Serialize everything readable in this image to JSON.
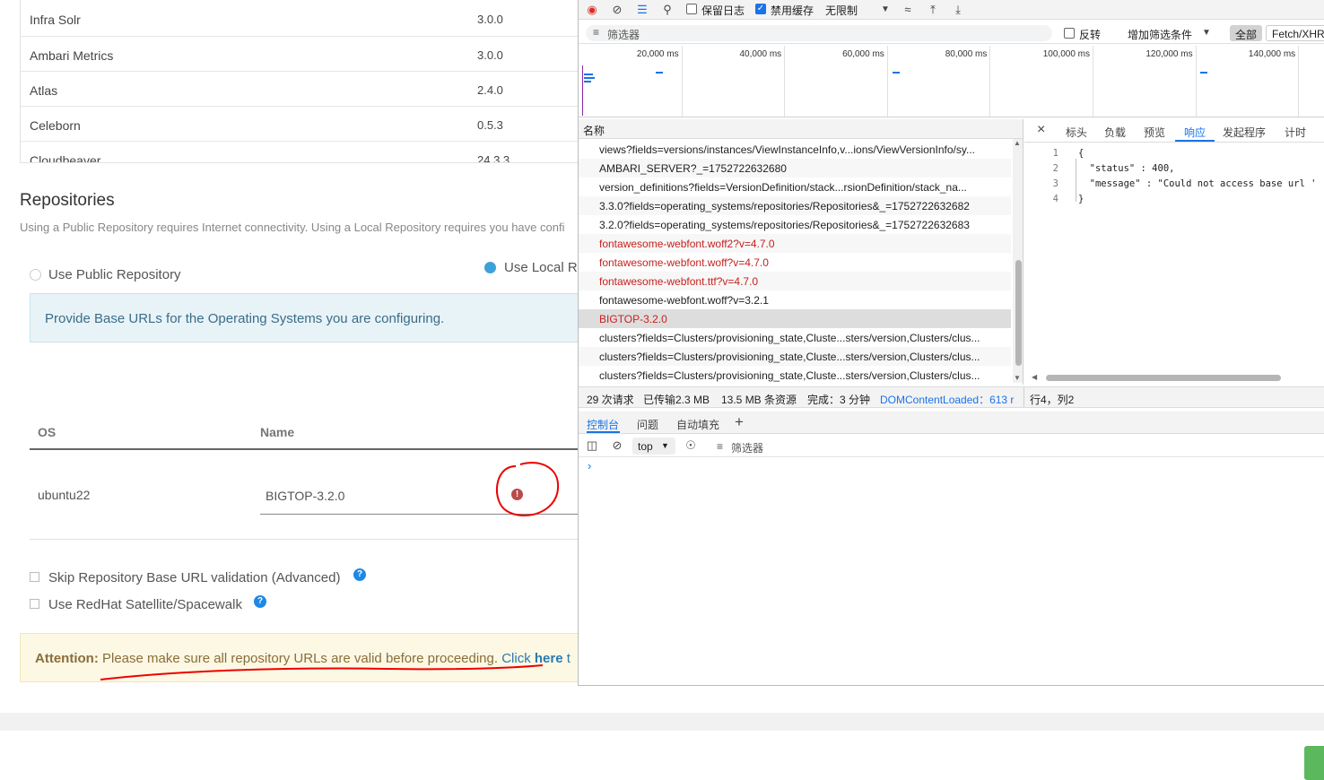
{
  "services": [
    {
      "name": "Infra Solr",
      "version": "3.0.0"
    },
    {
      "name": "Ambari Metrics",
      "version": "3.0.0"
    },
    {
      "name": "Atlas",
      "version": "2.4.0"
    },
    {
      "name": "Celeborn",
      "version": "0.5.3"
    },
    {
      "name": "Cloudbeaver",
      "version": "24.3.3"
    }
  ],
  "repositories": {
    "title": "Repositories",
    "description": "Using a Public Repository requires Internet connectivity. Using a Local Repository requires you have confi",
    "public_label": "Use Public Repository",
    "local_label": "Use Local R",
    "info": "Provide Base URLs for the Operating Systems you are configuring.",
    "col_os": "OS",
    "col_name": "Name",
    "os_value": "ubuntu22",
    "name_value": "BIGTOP-3.2.0",
    "error_glyph": "!",
    "skip_validation_label": "Skip Repository Base URL validation (Advanced)",
    "satellite_label": "Use RedHat Satellite/Spacewalk",
    "help_glyph": "?",
    "attention_label": "Attention:",
    "attention_text": " Please make sure all repository URLs are valid before proceeding. ",
    "attention_link_1": "Click ",
    "attention_link_2": "here",
    "attention_link_3": " t"
  },
  "devtools": {
    "toolbar": {
      "preserve_log": "保留日志",
      "disable_cache": "禁用缓存",
      "throttle": "无限制"
    },
    "filter": {
      "placeholder": "筛选器",
      "invert": "反转",
      "more_filters": "增加筛选条件",
      "all": "全部",
      "fetch_xhr": "Fetch/XHR"
    },
    "timeline_labels": [
      "20,000 ms",
      "40,000 ms",
      "60,000 ms",
      "80,000 ms",
      "100,000 ms",
      "120,000 ms",
      "140,000 ms"
    ],
    "name_header": "名称",
    "requests": [
      {
        "name": "views?fields=versions/instances/ViewInstanceInfo,v...ions/ViewVersionInfo/sy...",
        "error": false
      },
      {
        "name": "AMBARI_SERVER?_=1752722632680",
        "error": false
      },
      {
        "name": "version_definitions?fields=VersionDefinition/stack...rsionDefinition/stack_na...",
        "error": false
      },
      {
        "name": "3.3.0?fields=operating_systems/repositories/Repositories&_=1752722632682",
        "error": false
      },
      {
        "name": "3.2.0?fields=operating_systems/repositories/Repositories&_=1752722632683",
        "error": false
      },
      {
        "name": "fontawesome-webfont.woff2?v=4.7.0",
        "error": true
      },
      {
        "name": "fontawesome-webfont.woff?v=4.7.0",
        "error": true
      },
      {
        "name": "fontawesome-webfont.ttf?v=4.7.0",
        "error": true
      },
      {
        "name": "fontawesome-webfont.woff?v=3.2.1",
        "error": false
      },
      {
        "name": "BIGTOP-3.2.0",
        "error": true
      },
      {
        "name": "clusters?fields=Clusters/provisioning_state,Cluste...sters/version,Clusters/clus...",
        "error": false
      },
      {
        "name": "clusters?fields=Clusters/provisioning_state,Cluste...sters/version,Clusters/clus...",
        "error": false
      },
      {
        "name": "clusters?fields=Clusters/provisioning_state,Cluste...sters/version,Clusters/clus...",
        "error": false
      }
    ],
    "detail_tabs": [
      "标头",
      "负载",
      "预览",
      "响应",
      "发起程序",
      "计时"
    ],
    "active_detail_tab": "响应",
    "response_lines": [
      {
        "ln": "1",
        "text": "{"
      },
      {
        "ln": "2",
        "text": "  \"status\" : 400,"
      },
      {
        "ln": "3",
        "text": "  \"message\" : \"Could not access base url '"
      },
      {
        "ln": "4",
        "text": "}"
      }
    ],
    "status": {
      "requests": "29 次请求",
      "transferred": "已传输2.3 MB",
      "resources": "13.5 MB 条资源",
      "finish": "完成：3 分钟",
      "dom_loaded": "DOMContentLoaded：613 r",
      "cursor": "行4，列2"
    },
    "drawer_tabs": [
      "控制台",
      "问题",
      "自动填充"
    ],
    "console_context": "top",
    "console_filter": "筛选器",
    "prompt": "›"
  }
}
